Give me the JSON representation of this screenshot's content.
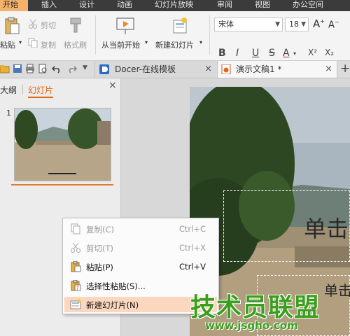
{
  "ribbon_tabs": [
    "开始",
    "插入",
    "设计",
    "动画",
    "幻灯片放映",
    "审阅",
    "视图",
    "办公空间"
  ],
  "ribbon": {
    "paste": "粘贴",
    "cut": "剪切",
    "copy": "复制",
    "format_painter": "格式刷",
    "from_current": "从当前开始",
    "new_slide": "新建幻灯片",
    "font_name": "宋体",
    "font_size": "18",
    "format_buttons": [
      "B",
      "I",
      "U",
      "S",
      "A",
      "X²",
      "X₂"
    ]
  },
  "doc_tabs": [
    {
      "label": "Docer-在线模板",
      "close": "×"
    },
    {
      "label": "演示文稿1 *",
      "close": "×"
    }
  ],
  "new_tab_plus": "+",
  "left_panel": {
    "tabs": [
      "大纲",
      "幻灯片"
    ],
    "close": "×",
    "slide_number": "1"
  },
  "slide": {
    "title_text": "单击",
    "subtitle_text": "单击"
  },
  "context_menu": [
    {
      "label": "复制(C)",
      "shortcut": "Ctrl+C",
      "enabled": false,
      "icon": "copy-icon"
    },
    {
      "label": "剪切(T)",
      "shortcut": "Ctrl+X",
      "enabled": false,
      "icon": "scissors-icon"
    },
    {
      "label": "粘贴(P)",
      "shortcut": "Ctrl+V",
      "enabled": true,
      "icon": "clipboard-icon"
    },
    {
      "label": "选择性粘贴(S)...",
      "shortcut": "",
      "enabled": true,
      "icon": "paste-special-icon"
    },
    {
      "label": "新建幻灯片(N)",
      "shortcut": "",
      "enabled": true,
      "highlighted": true,
      "icon": "new-slide-icon"
    }
  ],
  "watermark": {
    "line1": "技术员联盟",
    "line2": "www.jsgho.com"
  },
  "colors": {
    "active_tab": "#f6b26b",
    "accent_orange": "#e06a12",
    "menu_highlight": "#fbd7be",
    "watermark_green": "#3a9f1c"
  }
}
